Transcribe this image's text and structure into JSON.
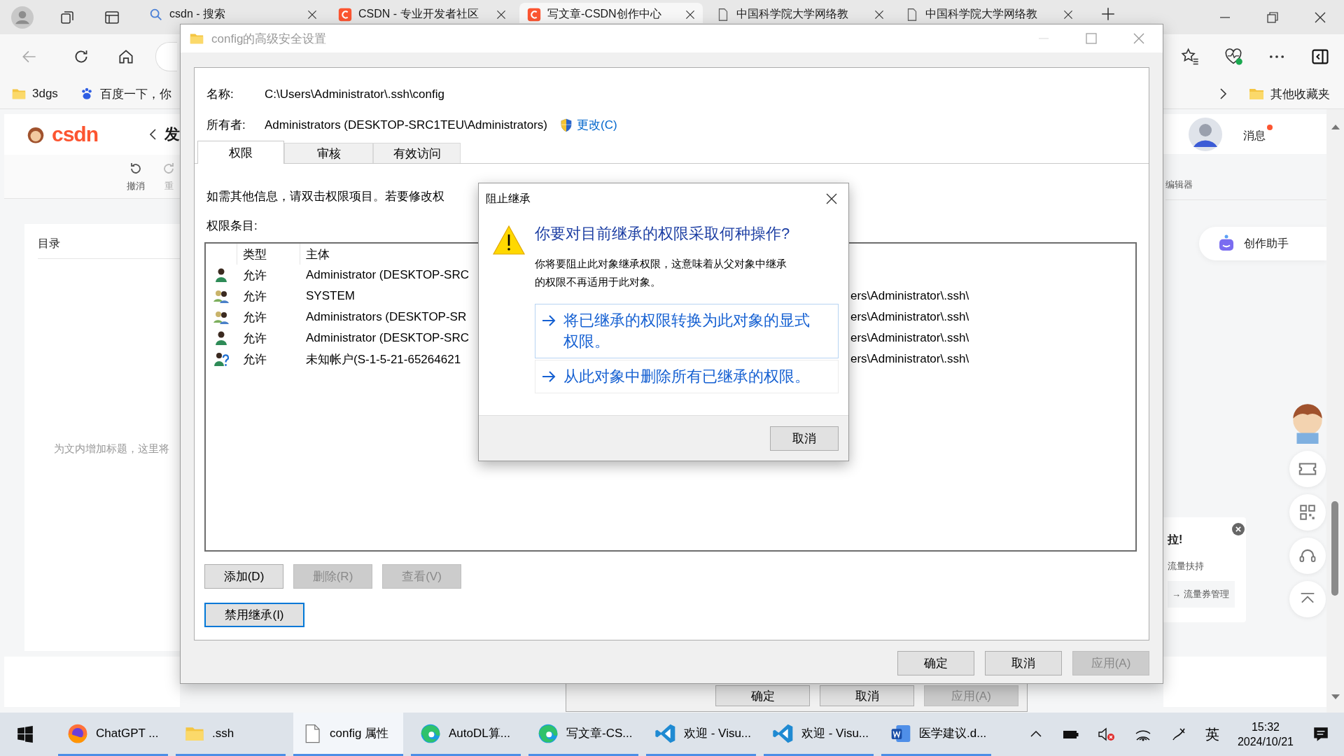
{
  "browser": {
    "tabs": [
      {
        "title": "csdn - 搜索",
        "kind": "search",
        "selected": false
      },
      {
        "title": "CSDN - 专业开发者社区",
        "kind": "csdn",
        "selected": false
      },
      {
        "title": "写文章-CSDN创作中心",
        "kind": "csdn",
        "selected": true
      },
      {
        "title": "中国科学院大学网络教",
        "kind": "page",
        "selected": false
      },
      {
        "title": "中国科学院大学网络教",
        "kind": "page",
        "selected": false
      }
    ],
    "bookmarks": [
      {
        "label": "3dgs",
        "kind": "folder"
      },
      {
        "label": "百度一下，你",
        "kind": "paw"
      }
    ],
    "other_bookmarks": "其他收藏夹"
  },
  "csdn": {
    "logo": "csdn",
    "heading": "发",
    "toolbar": [
      {
        "label": "撤消",
        "kind": "undo",
        "disabled": false
      },
      {
        "label": "重",
        "kind": "redo",
        "disabled": true
      }
    ],
    "toc_title": "目录",
    "toc_hint": "为文内增加标题，这里将",
    "messages": {
      "label": "消息",
      "unread": true
    },
    "editor_label": "编辑器",
    "assistant": "创作助手",
    "promo": {
      "title": "拉!",
      "text": "流量扶持",
      "link": "→ 流量券管理"
    }
  },
  "properties_dialog": {
    "buttons": [
      {
        "label": "确定",
        "disabled": false
      },
      {
        "label": "取消",
        "disabled": false
      },
      {
        "label": "应用(A)",
        "disabled": true
      }
    ]
  },
  "security_dialog": {
    "title": "config的高级安全设置",
    "name_label": "名称:",
    "name_value": "C:\\Users\\Administrator\\.ssh\\config",
    "owner_label": "所有者:",
    "owner_value": "Administrators (DESKTOP-SRC1TEU\\Administrators)",
    "change_link": "更改(C)",
    "tabs": [
      {
        "label": "权限",
        "selected": true
      },
      {
        "label": "审核",
        "selected": false
      },
      {
        "label": "有效访问",
        "selected": false
      }
    ],
    "info_text": "如需其他信息，请双击权限项目。若要修改权",
    "entries_label": "权限条目:",
    "columns": [
      "类型",
      "主体"
    ],
    "entries": [
      {
        "kind": "user",
        "type": "允许",
        "principal": "Administrator (DESKTOP-SRC"
      },
      {
        "kind": "group",
        "type": "允许",
        "principal": "SYSTEM",
        "access": "ers\\Administrator\\.ssh\\"
      },
      {
        "kind": "group",
        "type": "允许",
        "principal": "Administrators (DESKTOP-SR",
        "access": "ers\\Administrator\\.ssh\\"
      },
      {
        "kind": "user",
        "type": "允许",
        "principal": "Administrator (DESKTOP-SRC",
        "access": "ers\\Administrator\\.ssh\\"
      },
      {
        "kind": "unknown",
        "type": "允许",
        "principal": "未知帐户(S-1-5-21-65264621",
        "access": "ers\\Administrator\\.ssh\\"
      }
    ],
    "buttons": [
      {
        "label": "添加(D)",
        "disabled": false
      },
      {
        "label": "删除(R)",
        "disabled": true
      },
      {
        "label": "查看(V)",
        "disabled": true
      }
    ],
    "inheritance_button": {
      "label": "禁用继承(I)",
      "focused": true
    },
    "footer_buttons": [
      {
        "label": "确定",
        "disabled": false
      },
      {
        "label": "取消",
        "disabled": false
      },
      {
        "label": "应用(A)",
        "disabled": true
      }
    ]
  },
  "block_dialog": {
    "title": "阻止继承",
    "question": "你要对目前继承的权限采取何种操作?",
    "description": "你将要阻止此对象继承权限，这意味着从父对象中继承的权限不再适用于此对象。",
    "options": [
      {
        "label": "将已继承的权限转换为此对象的显式权限。",
        "hovered": true
      },
      {
        "label": "从此对象中删除所有已继承的权限。",
        "hovered": false
      }
    ],
    "cancel": "取消"
  },
  "taskbar": {
    "apps": [
      {
        "label": "ChatGPT ...",
        "kind": "firefox",
        "selected": false
      },
      {
        "label": ".ssh",
        "kind": "folder",
        "selected": false
      },
      {
        "label": "config 属性",
        "kind": "file",
        "selected": true
      },
      {
        "label": "AutoDL算...",
        "kind": "edge",
        "selected": false
      },
      {
        "label": "写文章-CS...",
        "kind": "edge",
        "selected": false
      },
      {
        "label": "欢迎 - Visu...",
        "kind": "vscode",
        "selected": false
      },
      {
        "label": "欢迎 - Visu...",
        "kind": "vscode",
        "selected": false
      },
      {
        "label": "医学建议.d...",
        "kind": "word",
        "selected": false
      }
    ],
    "input_method": "英",
    "time": "15:32",
    "date": "2024/10/21"
  }
}
